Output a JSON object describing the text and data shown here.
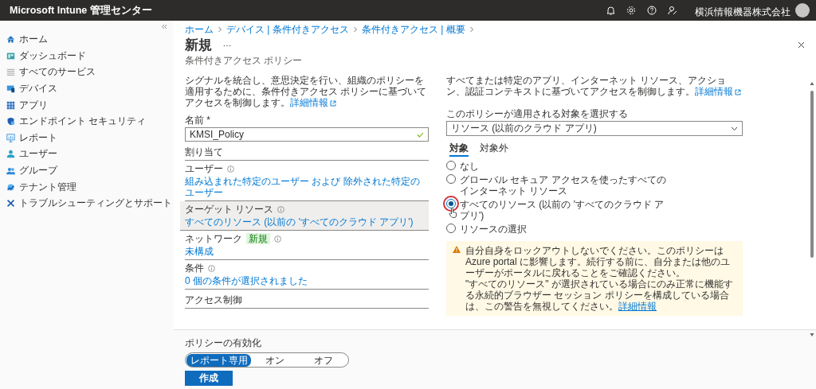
{
  "topbar": {
    "title": "Microsoft Intune 管理センター",
    "account": "横浜情報機器株式会社"
  },
  "sidebar": {
    "items": [
      {
        "label": "ホーム"
      },
      {
        "label": "ダッシュボード"
      },
      {
        "label": "すべてのサービス"
      },
      {
        "label": "デバイス"
      },
      {
        "label": "アプリ"
      },
      {
        "label": "エンドポイント セキュリティ"
      },
      {
        "label": "レポート"
      },
      {
        "label": "ユーザー"
      },
      {
        "label": "グループ"
      },
      {
        "label": "テナント管理"
      },
      {
        "label": "トラブルシューティングとサポート"
      }
    ]
  },
  "breadcrumb": [
    "ホーム",
    "デバイス | 条件付きアクセス",
    "条件付きアクセス | 概要"
  ],
  "page": {
    "title": "新規",
    "subtitle": "条件付きアクセス ポリシー"
  },
  "left": {
    "description": "シグナルを統合し、意思決定を行い、組織のポリシーを適用するために、条件付きアクセス ポリシーに基づいてアクセスを制御します。",
    "link": "詳細情報",
    "name_label": "名前 *",
    "name_value": "KMSI_Policy",
    "assignments_heading": "割り当て",
    "sections": [
      {
        "label": "ユーザー",
        "value": "組み込まれた特定のユーザー および 除外された特定のユーザー",
        "selected": false
      },
      {
        "label": "ターゲット リソース",
        "value": "すべてのリソース (以前の 'すべてのクラウド アプリ')",
        "selected": true
      },
      {
        "label": "ネットワーク",
        "badge": "新規",
        "value": "未構成",
        "selected": false
      },
      {
        "label": "条件",
        "value": "0 個の条件が選択されました",
        "selected": false
      }
    ],
    "access_heading": "アクセス制御"
  },
  "right": {
    "description": "すべてまたは特定のアプリ、インターネット リソース、アクション、認証コンテキストに基づいてアクセスを制御します。",
    "link": "詳細情報",
    "select_label": "このポリシーが適用される対象を選択する",
    "select_value": "リソース (以前のクラウド アプリ)",
    "tabs": [
      {
        "label": "対象",
        "selected": true
      },
      {
        "label": "対象外",
        "selected": false
      }
    ],
    "options": [
      {
        "label": "なし",
        "selected": false,
        "highlighted": false
      },
      {
        "label": "グローバル セキュア アクセスを使ったすべてのインターネット リソース",
        "selected": false,
        "highlighted": false
      },
      {
        "label": "すべてのリソース (以前の 'すべてのクラウド アプリ')",
        "selected": true,
        "highlighted": true
      },
      {
        "label": "リソースの選択",
        "selected": false,
        "highlighted": false
      }
    ],
    "warning": {
      "text": "自分自身をロックアウトしないでください。このポリシーは Azure portal に影響します。続行する前に、自分または他のユーザーがポータルに戻れることをご確認ください。",
      "text2": "\"すべてのリソース\" が選択されている場合にのみ正常に機能する永続的ブラウザー セッション ポリシーを構成している場合は、この警告を無視してください。",
      "link": "詳細情報"
    }
  },
  "footer": {
    "label": "ポリシーの有効化",
    "segments": [
      {
        "label": "レポート専用",
        "selected": true
      },
      {
        "label": "オン",
        "selected": false
      },
      {
        "label": "オフ",
        "selected": false
      }
    ],
    "create": "作成"
  }
}
